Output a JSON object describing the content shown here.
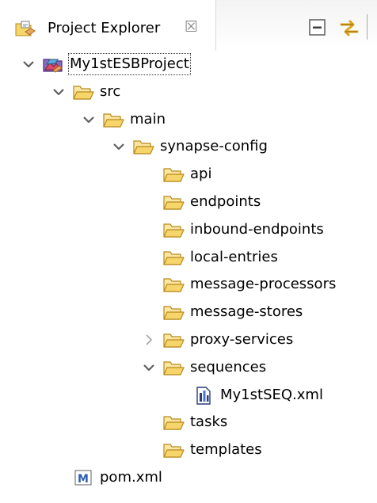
{
  "view": {
    "title": "Project Explorer",
    "close_glyph": "☒",
    "icon": "project-explorer-icon",
    "toolbar": [
      {
        "name": "collapse-all-icon",
        "tooltip": ""
      },
      {
        "name": "link-with-editor-icon",
        "tooltip": ""
      }
    ]
  },
  "tree": {
    "nodes": [
      {
        "label": "My1stESBProject",
        "icon": "esb-project-icon",
        "expanded": true,
        "depth": 0
      },
      {
        "label": "src",
        "icon": "folder-icon",
        "expanded": true,
        "depth": 1
      },
      {
        "label": "main",
        "icon": "folder-icon",
        "expanded": true,
        "depth": 2
      },
      {
        "label": "synapse-config",
        "icon": "folder-icon",
        "expanded": true,
        "depth": 3
      },
      {
        "label": "api",
        "icon": "folder-icon",
        "expanded": null,
        "depth": 4
      },
      {
        "label": "endpoints",
        "icon": "folder-icon",
        "expanded": null,
        "depth": 4
      },
      {
        "label": "inbound-endpoints",
        "icon": "folder-icon",
        "expanded": null,
        "depth": 4
      },
      {
        "label": "local-entries",
        "icon": "folder-icon",
        "expanded": null,
        "depth": 4
      },
      {
        "label": "message-processors",
        "icon": "folder-icon",
        "expanded": null,
        "depth": 4
      },
      {
        "label": "message-stores",
        "icon": "folder-icon",
        "expanded": null,
        "depth": 4
      },
      {
        "label": "proxy-services",
        "icon": "folder-icon",
        "expanded": false,
        "depth": 4
      },
      {
        "label": "sequences",
        "icon": "folder-icon",
        "expanded": true,
        "depth": 4
      },
      {
        "label": "My1stSEQ.xml",
        "icon": "sequence-file-icon",
        "expanded": null,
        "depth": 5
      },
      {
        "label": "tasks",
        "icon": "folder-icon",
        "expanded": null,
        "depth": 4
      },
      {
        "label": "templates",
        "icon": "folder-icon",
        "expanded": null,
        "depth": 4
      },
      {
        "label": "pom.xml",
        "icon": "maven-pom-icon",
        "expanded": null,
        "depth": 1
      }
    ]
  },
  "colors": {
    "folder_fill": "#f6d56b",
    "folder_stroke": "#b88a1c",
    "twisty": "#5f5f5f",
    "twisty_collapsed": "#a9a9a9",
    "maven_blue": "#2a5db0",
    "file_dark": "#2b3c7a"
  }
}
